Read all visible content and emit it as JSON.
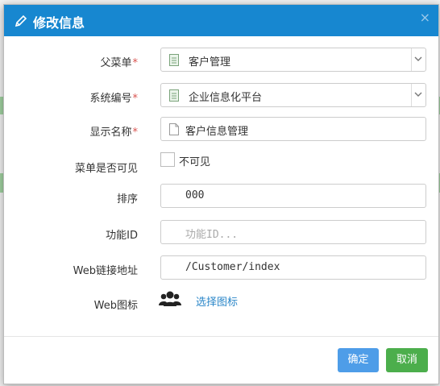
{
  "modal": {
    "title": "修改信息",
    "close_glyph": "×"
  },
  "form": {
    "parent_menu": {
      "label": "父菜单",
      "value": "客户管理"
    },
    "system_code": {
      "label": "系统编号",
      "value": "企业信息化平台"
    },
    "display_name": {
      "label": "显示名称",
      "value": "客户信息管理"
    },
    "visible": {
      "label": "菜单是否可见",
      "option_label": "不可见",
      "checked": false
    },
    "sort": {
      "label": "排序",
      "value": "000"
    },
    "function_id": {
      "label": "功能ID",
      "placeholder": "功能ID..."
    },
    "web_url": {
      "label": "Web链接地址",
      "value": "/Customer/index"
    },
    "web_icon": {
      "label": "Web图标",
      "link_text": "选择图标",
      "icon": "users-icon"
    }
  },
  "required_mark": "*",
  "buttons": {
    "ok": "确定",
    "cancel": "取消"
  },
  "colors": {
    "header": "#1787d0",
    "ok": "#4e9de8",
    "cancel": "#4cae4c",
    "required": "#d9534f",
    "link": "#2a86c8"
  }
}
